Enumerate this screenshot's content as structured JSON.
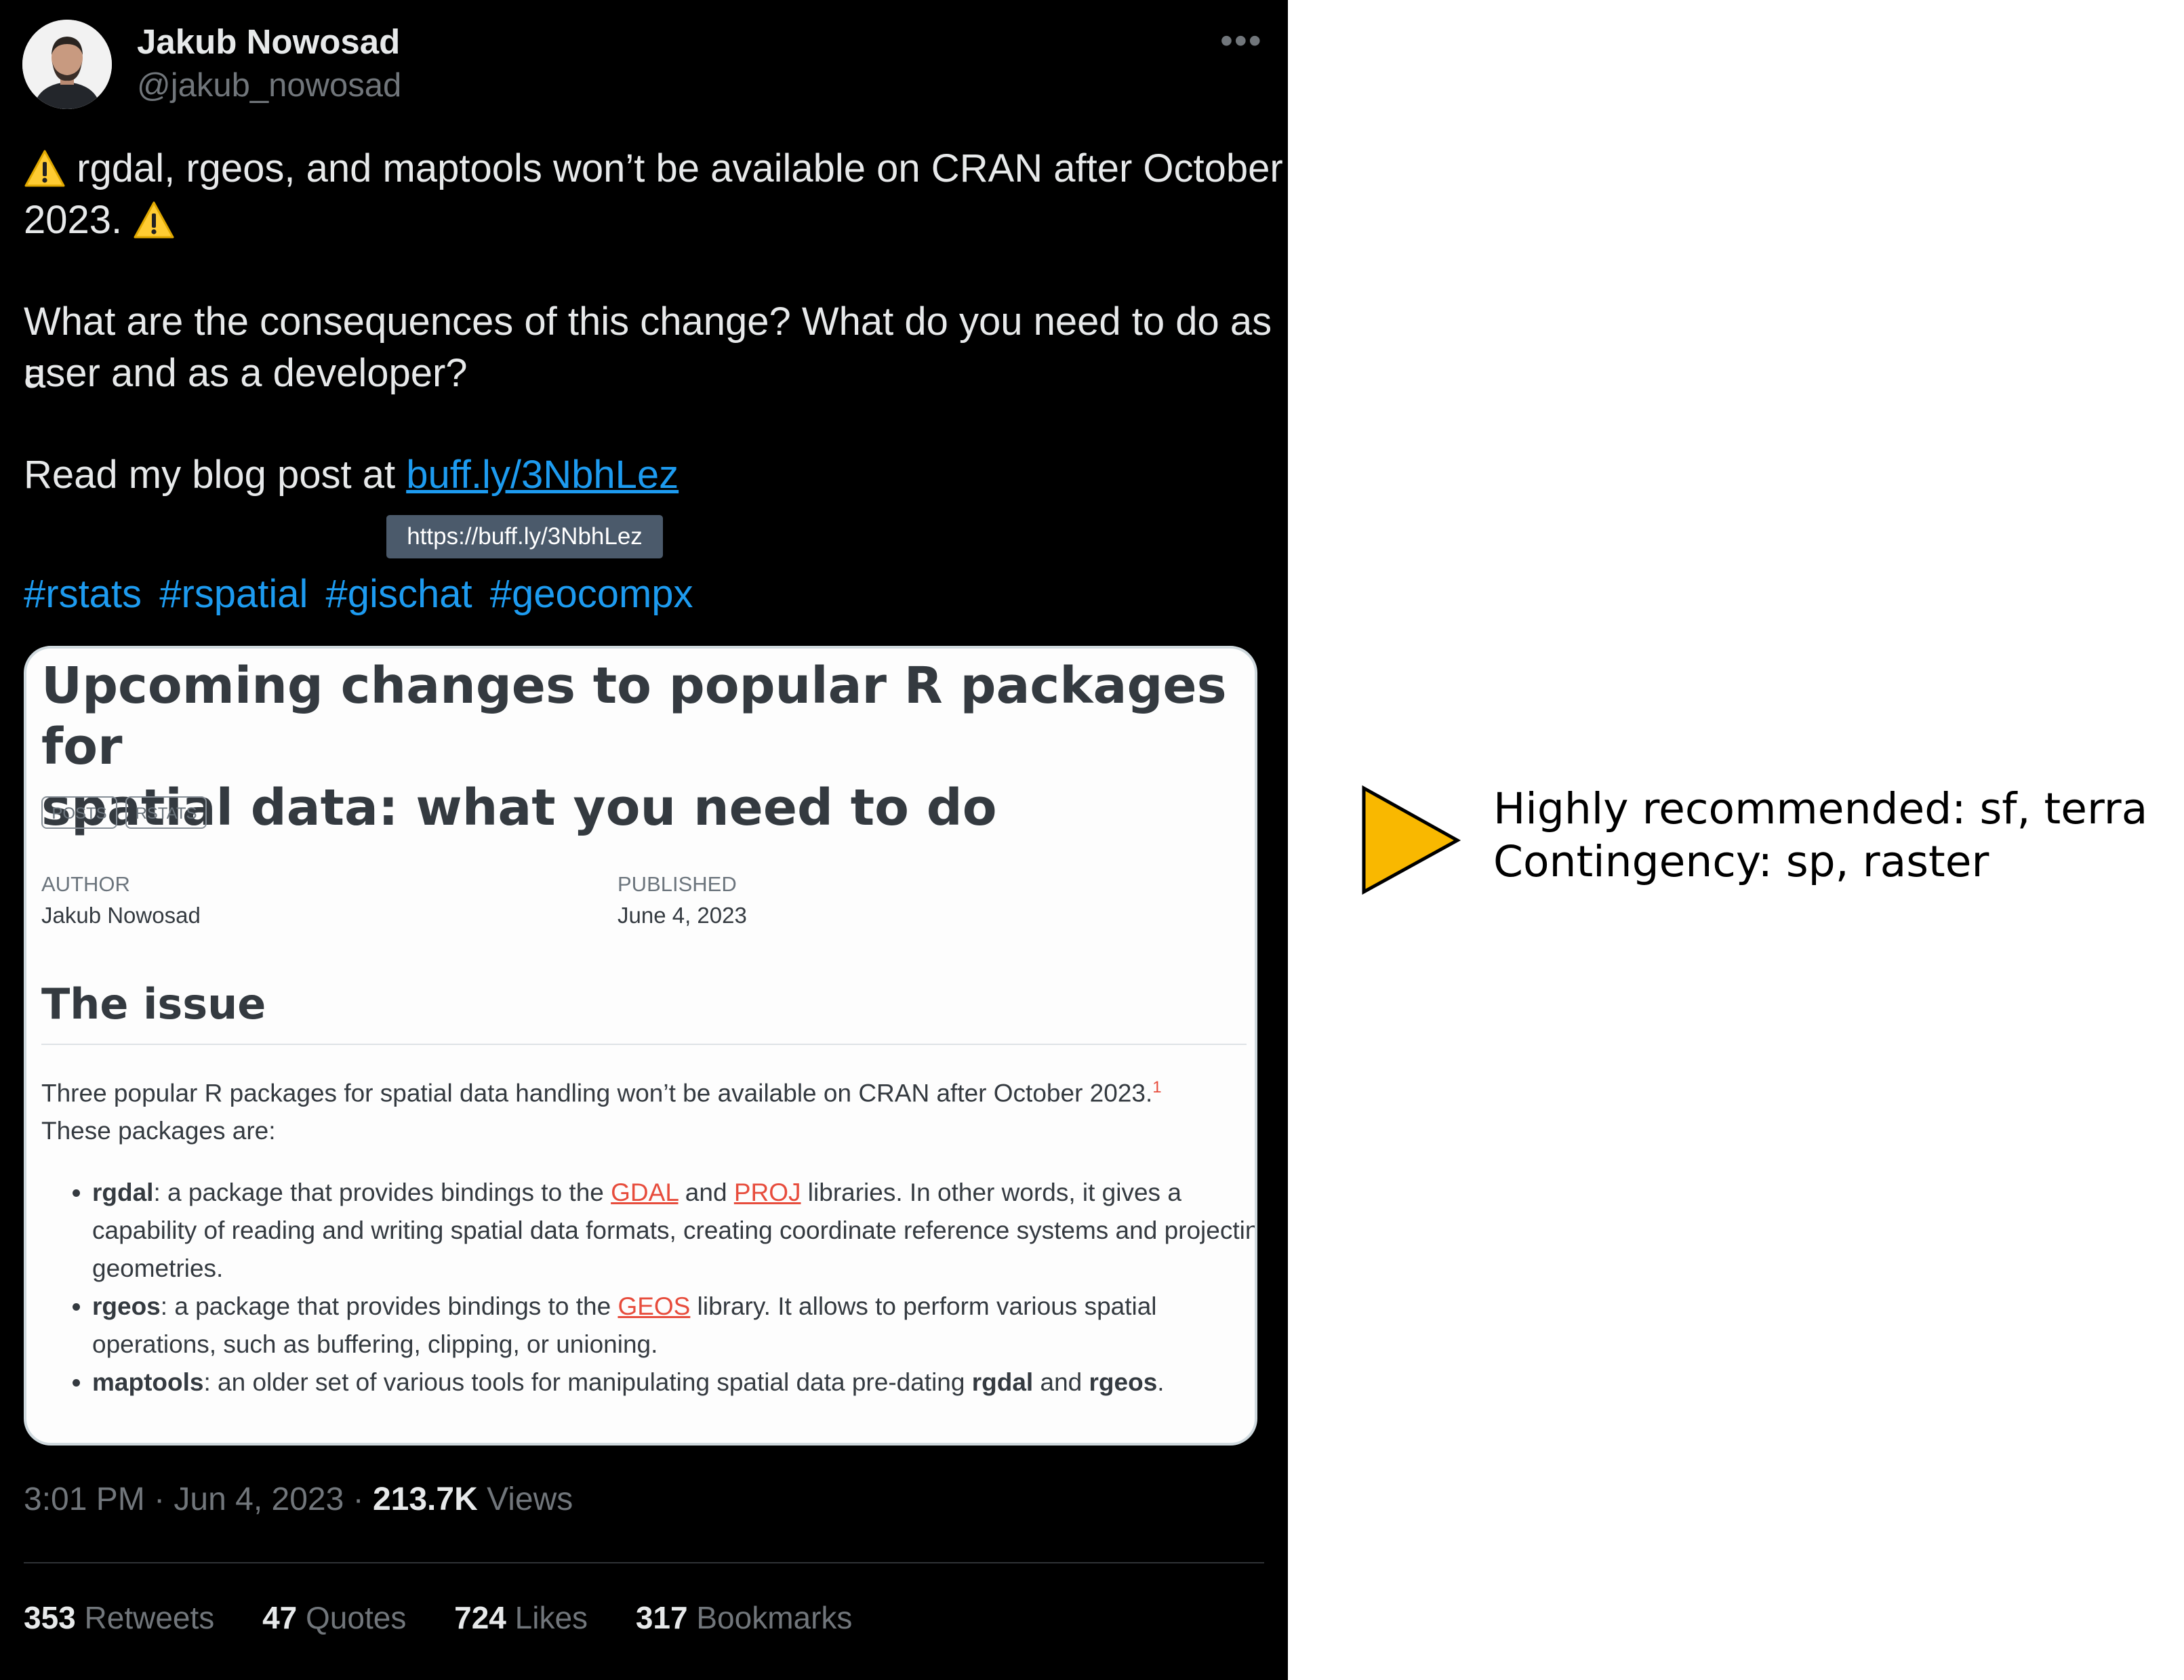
{
  "tweet": {
    "author_name": "Jakub Nowosad",
    "author_handle": "@jakub_nowosad",
    "more_icon": "more-horizontal-icon",
    "warning_icon": "warning-icon",
    "line1_text": "rgdal, rgeos, and maptools won’t be available on CRAN after October",
    "line2_text": "2023.",
    "question_line1": "What are the consequences of this change? What do you need to do as a",
    "question_line2": "user and as a developer?",
    "read_prefix": "Read my blog post at ",
    "link_text": "buff.ly/3NbhLez",
    "link_tooltip": "https://buff.ly/3NbhLez",
    "hashtags": [
      "#rstats",
      "#rspatial",
      "#gischat",
      "#geocompx"
    ],
    "timestamp_prefix": "3:01 PM · Jun 4, 2023 · ",
    "views_count": "213.7K",
    "views_label": " Views",
    "stats": [
      {
        "count": "353",
        "label": " Retweets"
      },
      {
        "count": "47",
        "label": " Quotes"
      },
      {
        "count": "724",
        "label": " Likes"
      },
      {
        "count": "317",
        "label": " Bookmarks"
      }
    ]
  },
  "card": {
    "title_line1": "Upcoming changes to popular R packages for",
    "title_line2": "spatial data: what you need to do",
    "tags": [
      "POSTS",
      "RSTATS"
    ],
    "author_label": "AUTHOR",
    "author_value": "Jakub Nowosad",
    "published_label": "PUBLISHED",
    "published_value": "June 4, 2023",
    "section_heading": "The issue",
    "intro_line1": "Three popular R packages for spatial data handling won’t be available on CRAN after October 2023.",
    "intro_footnote": "1",
    "intro_line2": "These packages are:",
    "b1_name": "rgdal",
    "b1_t1": ": a package that provides bindings to the ",
    "b1_link1": "GDAL",
    "b1_t2": " and ",
    "b1_link2": "PROJ",
    "b1_t3": " libraries. In other words, it gives a capability of reading and writing spatial data formats, creating coordinate reference systems and projecting geometries.",
    "b2_name": "rgeos",
    "b2_t1": ": a package that provides bindings to the ",
    "b2_link": "GEOS",
    "b2_t2": " library. It allows to perform various spatial operations, such as buffering, clipping, or unioning.",
    "b3_name": "maptools",
    "b3_t1": ": an older set of various tools for manipulating spatial data pre-dating ",
    "b3_bold1": "rgdal",
    "b3_t2": " and ",
    "b3_bold2": "rgeos",
    "b3_t3": "."
  },
  "annotation": {
    "arrow_icon": "play-triangle-icon",
    "arrow_color": "#f9b800",
    "line1": "Highly recommended: sf, terra",
    "line2": "Contingency: sp, raster"
  },
  "colors": {
    "tweet_background": "#000000",
    "link": "#1d9bf0",
    "card_link": "#e74c3c"
  }
}
